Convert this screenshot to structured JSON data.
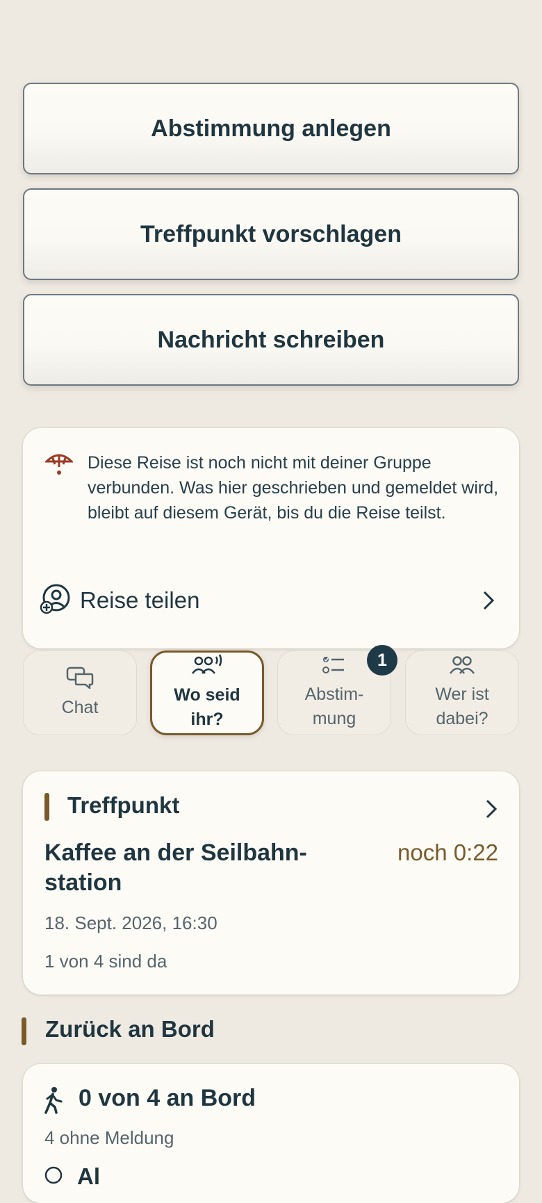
{
  "actions": {
    "create_poll": "Abstimmung anlegen",
    "suggest_meeting": "Treffpunkt vorschlagen",
    "write_message": "Nachricht schreiben"
  },
  "notice": {
    "text": "Diese Reise ist noch nicht mit deiner Gruppe verbunden. Was hier geschrieben und gemeldet wird, bleibt auf diesem Gerät, bis du die Reise teilst.",
    "share_label": "Reise teilen"
  },
  "tabs": [
    {
      "line1": "Chat",
      "line2": ""
    },
    {
      "line1": "Wo seid",
      "line2": "ihr?"
    },
    {
      "line1": "Abstim-",
      "line2": "mung"
    },
    {
      "line1": "Wer ist",
      "line2": "dabei?"
    }
  ],
  "badge_count": "1",
  "meeting": {
    "section": "Treffpunkt",
    "place_line1": "Kaffee an der Seilbahn-",
    "place_line2": "station",
    "countdown": "noch 0:22",
    "datetime": "18. Sept. 2026, 16:30",
    "arrived": "1 von 4 sind da"
  },
  "board": {
    "section": "Zurück an Bord",
    "count": "0 von 4 an Bord",
    "no_report": "4 ohne Meldung",
    "partial_row": "Al"
  },
  "colors": {
    "accent_brown": "#7a5a2a",
    "countdown": "#7a5a2a",
    "notice_icon": "#9a3a24",
    "badge": "#1e3a46"
  }
}
